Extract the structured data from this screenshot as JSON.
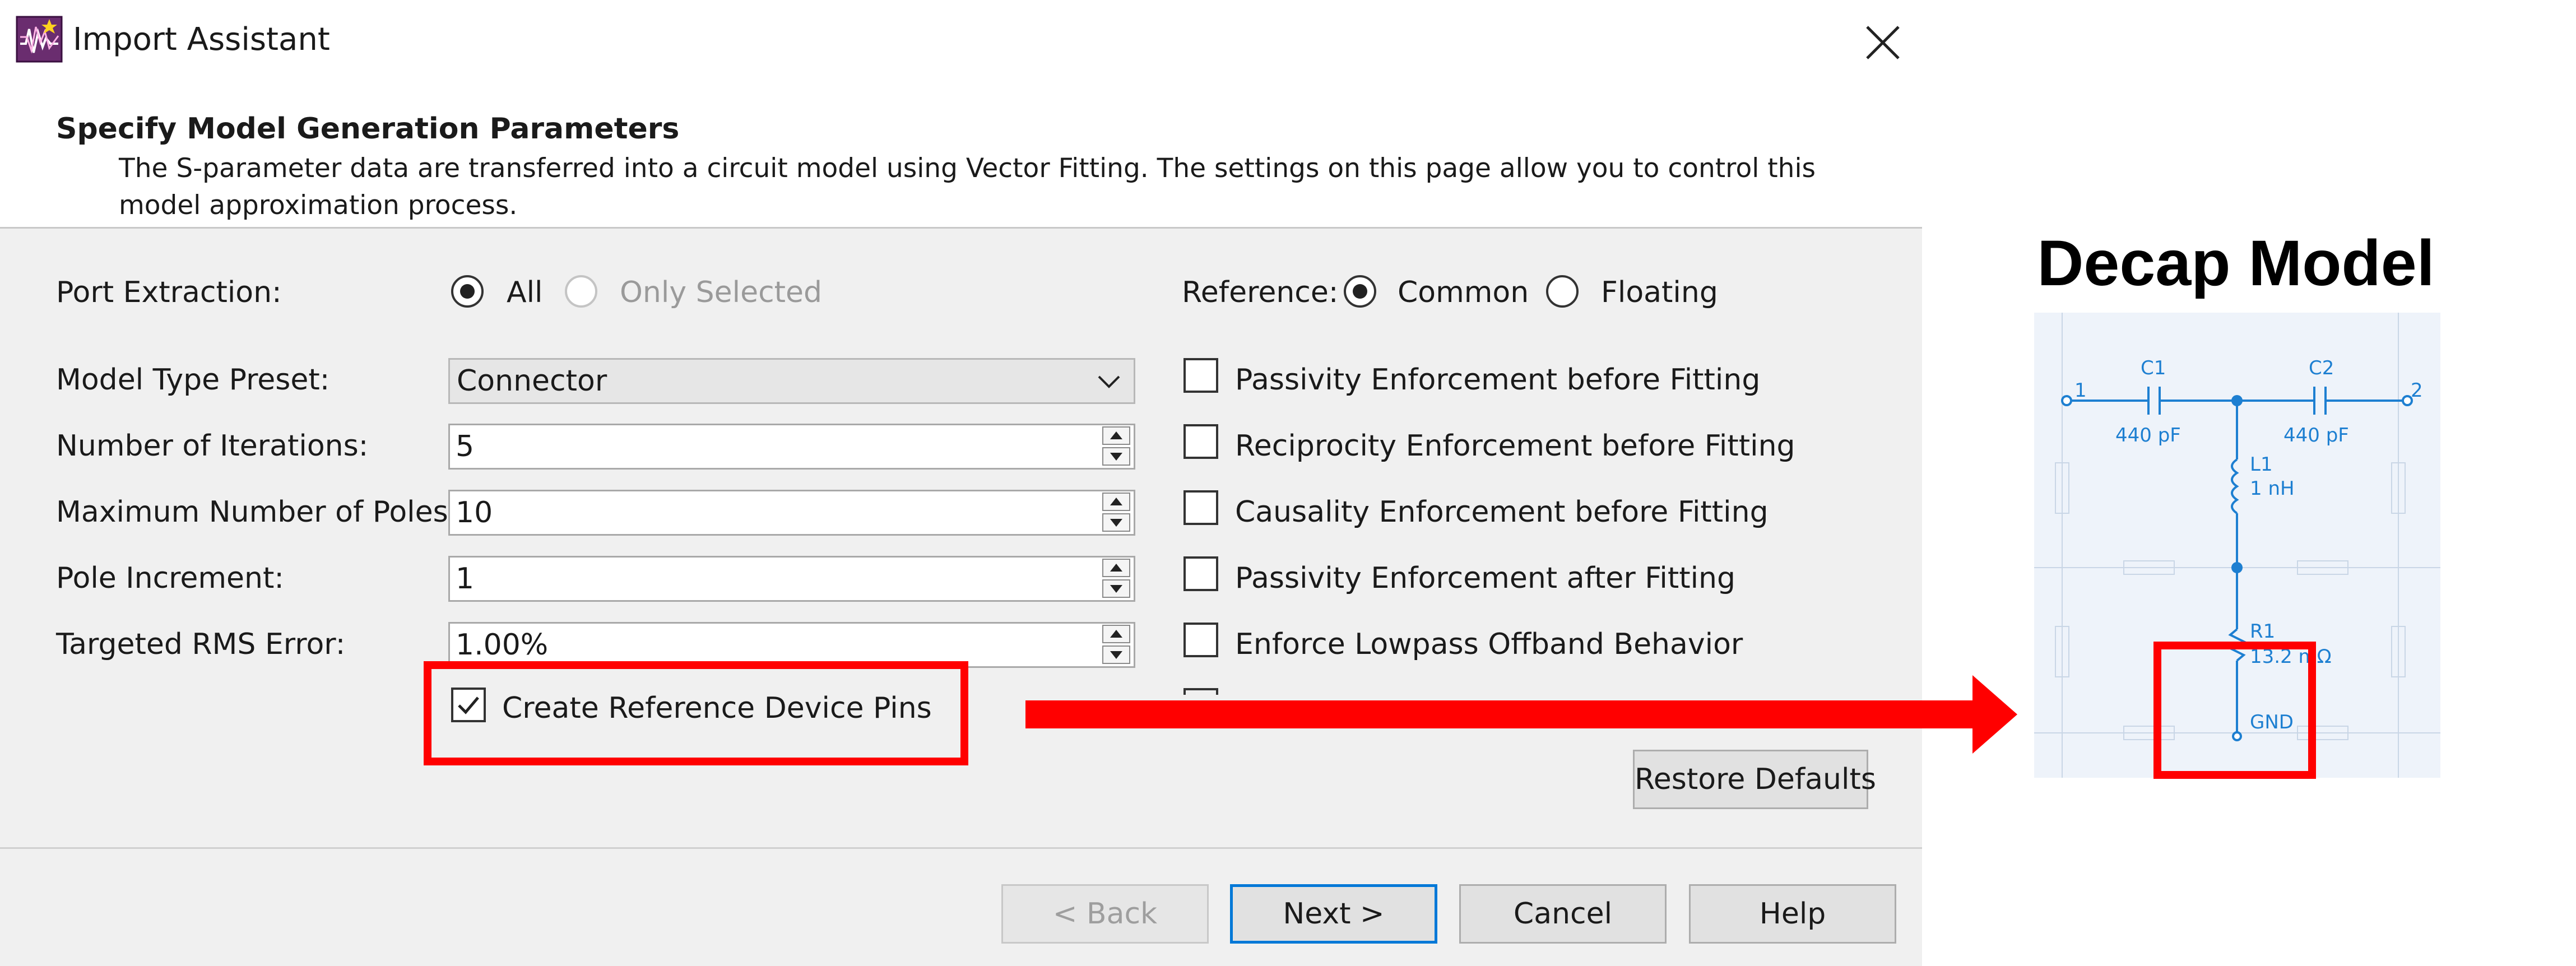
{
  "window": {
    "title": "Import Assistant",
    "icon": "app-waveform-icon",
    "close_icon": "close-icon"
  },
  "header": {
    "title": "Specify Model Generation Parameters",
    "description": "The S-parameter data are transferred into a circuit model using Vector Fitting. The settings on this page allow you to control this model approximation process."
  },
  "port_extraction": {
    "label": "Port Extraction:",
    "options": [
      "All",
      "Only Selected"
    ],
    "selected": "All"
  },
  "reference": {
    "label": "Reference:",
    "options": [
      "Common",
      "Floating"
    ],
    "selected": "Common"
  },
  "fields": {
    "model_type": {
      "label": "Model Type Preset:",
      "value": "Connector"
    },
    "iterations": {
      "label": "Number of Iterations:",
      "value": "5"
    },
    "max_poles": {
      "label": "Maximum Number of Poles:",
      "value": "10"
    },
    "pole_increment": {
      "label": "Pole Increment:",
      "value": "1"
    },
    "rms_error": {
      "label": "Targeted RMS Error:",
      "value": "1.00%"
    }
  },
  "checkboxes": {
    "passivity_before": {
      "label": "Passivity Enforcement before Fitting",
      "checked": false
    },
    "reciprocity_before": {
      "label": "Reciprocity Enforcement before Fitting",
      "checked": false
    },
    "causality_before": {
      "label": "Causality Enforcement before Fitting",
      "checked": false
    },
    "passivity_after": {
      "label": "Passivity Enforcement after Fitting",
      "checked": false
    },
    "lowpass_offband": {
      "label": "Enforce Lowpass Offband Behavior",
      "checked": false
    },
    "reference_pins": {
      "label": "Create Reference Device Pins",
      "checked": true
    }
  },
  "buttons": {
    "restore_defaults": "Restore Defaults",
    "back": "< Back",
    "next": "Next >",
    "cancel": "Cancel",
    "help": "Help"
  },
  "decap": {
    "title": "Decap Model",
    "c1": {
      "name": "C1",
      "value": "440 pF"
    },
    "c2": {
      "name": "C2",
      "value": "440 pF"
    },
    "l1": {
      "name": "L1",
      "value": "1 nH"
    },
    "r1": {
      "name": "R1",
      "value": "13.2 mΩ"
    },
    "port1": "1",
    "port2": "2",
    "gnd": "GND"
  },
  "colors": {
    "highlight": "#ff0000",
    "schematic_line": "#1d7fd1",
    "dialog_bg": "#f0f0f0",
    "default_button_border": "#0078d7"
  }
}
